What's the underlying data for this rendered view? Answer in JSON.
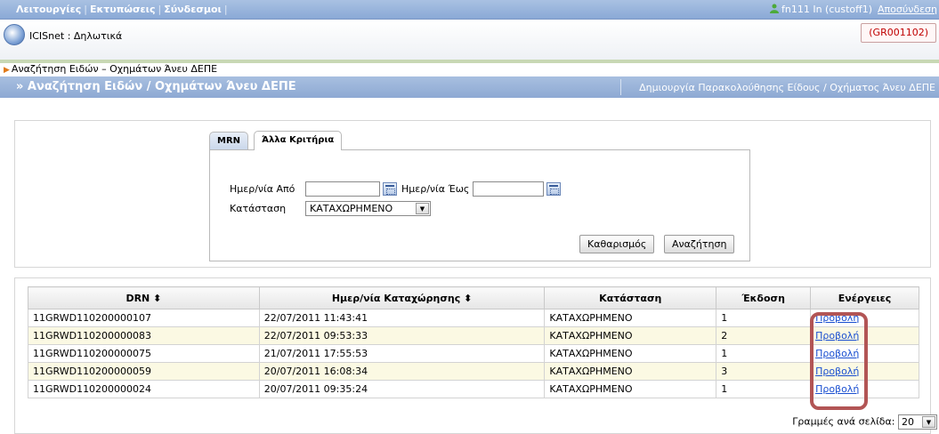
{
  "menu": {
    "items": [
      "Λειτουργίες",
      "Εκτυπώσεις",
      "Σύνδεσμοι"
    ]
  },
  "user": {
    "info": "fn111 In (custoff1)",
    "logout": "Αποσύνδεση"
  },
  "app": {
    "title": "ICISnet : Δηλωτικά",
    "office_code": "(GR001102)"
  },
  "breadcrumb": "Αναζήτηση Ειδών – Οχημάτων Άνευ ΔΕΠΕ",
  "page": {
    "title": "» Αναζήτηση Ειδών / Οχημάτων Άνευ ΔΕΠΕ",
    "create_link": "Δημιουργία Παρακολούθησης Είδους / Οχήματος Άνευ ΔΕΠΕ"
  },
  "search": {
    "tabs": [
      "MRN",
      "Άλλα Κριτήρια"
    ],
    "active_tab": "Άλλα Κριτήρια",
    "date_from_label": "Ημερ/νία Από",
    "date_from_value": "",
    "date_to_label": "Ημερ/νία Έως",
    "date_to_value": "",
    "status_label": "Κατάσταση",
    "status_value": "ΚΑΤΑΧΩΡΗΜΕΝΟ",
    "clear_button": "Καθαρισμός",
    "search_button": "Αναζήτηση"
  },
  "results": {
    "headers": [
      "DRN ⬍",
      "Ημερ/νία Καταχώρησης ⬍",
      "Κατάσταση",
      "Έκδοση",
      "Ενέργειες"
    ],
    "rows": [
      {
        "drn": "11GRWD110200000107",
        "date": "22/07/2011 11:43:41",
        "status": "ΚΑΤΑΧΩΡΗΜΕΝΟ",
        "version": "1",
        "action": "Προβολή"
      },
      {
        "drn": "11GRWD110200000083",
        "date": "22/07/2011 09:53:33",
        "status": "ΚΑΤΑΧΩΡΗΜΕΝΟ",
        "version": "2",
        "action": "Προβολή"
      },
      {
        "drn": "11GRWD110200000075",
        "date": "21/07/2011 17:55:53",
        "status": "ΚΑΤΑΧΩΡΗΜΕΝΟ",
        "version": "1",
        "action": "Προβολή"
      },
      {
        "drn": "11GRWD110200000059",
        "date": "20/07/2011 16:08:34",
        "status": "ΚΑΤΑΧΩΡΗΜΕΝΟ",
        "version": "3",
        "action": "Προβολή"
      },
      {
        "drn": "11GRWD110200000024",
        "date": "20/07/2011 09:35:24",
        "status": "ΚΑΤΑΧΩΡΗΜΕΝΟ",
        "version": "1",
        "action": "Προβολή"
      }
    ],
    "rows_per_page_label": "Γραμμές ανά σελίδα:",
    "rows_per_page_value": "20"
  },
  "icons": {
    "user": "user-icon",
    "logo": "icisnet-logo",
    "calendar": "calendar-icon",
    "dropdown": "chevron-down-icon"
  },
  "colors": {
    "topbar": "#8aa9d6",
    "highlight": "#b25555",
    "link": "#1a4fd0",
    "alt_row": "#fbf9e3",
    "badge_text": "#c00000"
  }
}
